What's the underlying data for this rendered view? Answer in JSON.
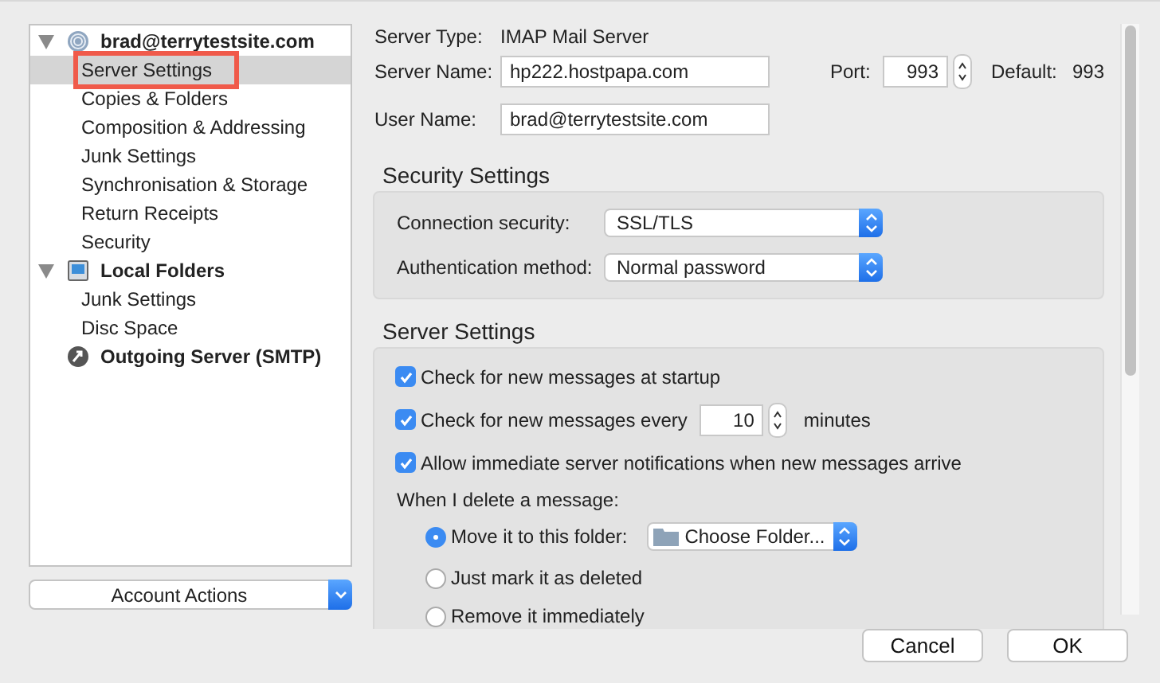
{
  "sidebar": {
    "items": [
      {
        "label": "brad@terrytestsite.com",
        "kind": "account",
        "expanded": true,
        "selected": false,
        "children": [
          {
            "label": "Server Settings",
            "selected": true,
            "highlighted": true
          },
          {
            "label": "Copies & Folders",
            "selected": false
          },
          {
            "label": "Composition & Addressing",
            "selected": false
          },
          {
            "label": "Junk Settings",
            "selected": false
          },
          {
            "label": "Synchronisation & Storage",
            "selected": false
          },
          {
            "label": "Return Receipts",
            "selected": false
          },
          {
            "label": "Security",
            "selected": false
          }
        ]
      },
      {
        "label": "Local Folders",
        "kind": "local",
        "expanded": true,
        "selected": false,
        "children": [
          {
            "label": "Junk Settings",
            "selected": false
          },
          {
            "label": "Disc Space",
            "selected": false
          }
        ]
      },
      {
        "label": "Outgoing Server (SMTP)",
        "kind": "smtp",
        "selected": false
      }
    ]
  },
  "account_actions": "Account Actions",
  "server": {
    "type_label": "Server Type:",
    "type_value": "IMAP Mail Server",
    "name_label": "Server Name:",
    "name_value": "hp222.hostpapa.com",
    "port_label": "Port:",
    "port_value": "993",
    "default_label": "Default:",
    "default_value": "993",
    "user_label": "User Name:",
    "user_value": "brad@terrytestsite.com"
  },
  "security": {
    "title": "Security Settings",
    "rows": [
      {
        "label": "Connection security:",
        "value": "SSL/TLS"
      },
      {
        "label": "Authentication method:",
        "value": "Normal password"
      }
    ]
  },
  "server_settings": {
    "title": "Server Settings",
    "checks": [
      {
        "label": "Check for new messages at startup",
        "checked": true
      },
      {
        "label": "Check for new messages every",
        "checked": true,
        "value": "10",
        "suffix": "minutes"
      },
      {
        "label": "Allow immediate server notifications when new messages arrive",
        "checked": true
      }
    ],
    "delete_label": "When I delete a message:",
    "radios": [
      {
        "label": "Move it to this folder:",
        "selected": true,
        "folder": "Choose Folder..."
      },
      {
        "label": "Just mark it as deleted",
        "selected": false
      },
      {
        "label": "Remove it immediately",
        "selected": false
      }
    ]
  },
  "buttons": [
    {
      "label": "Cancel",
      "default": false
    },
    {
      "label": "OK",
      "default": false
    }
  ]
}
